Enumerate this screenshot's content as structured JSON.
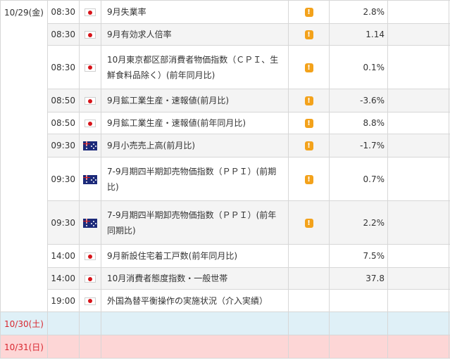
{
  "colors": {
    "saturday_row": "#dff0f7",
    "sunday_row": "#fdd6d6",
    "weekend_date_text": "#d8262e",
    "importance_icon": "#f3a21b"
  },
  "days": [
    {
      "date": "10/29(金)",
      "events": [
        {
          "time": "08:30",
          "country_icon": "japan-flag-icon",
          "name": "9月失業率",
          "importance_icon": "exclamation-icon",
          "importance_label": "!",
          "previous": "2.8%"
        },
        {
          "time": "08:30",
          "country_icon": "japan-flag-icon",
          "name": "9月有効求人倍率",
          "importance_icon": "exclamation-icon",
          "importance_label": "!",
          "previous": "1.14"
        },
        {
          "time": "08:30",
          "country_icon": "japan-flag-icon",
          "name": "10月東京都区部消費者物価指数（ＣＰＩ、生鮮食料品除く）(前年同月比)",
          "importance_icon": "exclamation-icon",
          "importance_label": "!",
          "previous": "0.1%"
        },
        {
          "time": "08:50",
          "country_icon": "japan-flag-icon",
          "name": "9月鉱工業生産・速報値(前月比)",
          "importance_icon": "exclamation-icon",
          "importance_label": "!",
          "previous": "-3.6%"
        },
        {
          "time": "08:50",
          "country_icon": "japan-flag-icon",
          "name": "9月鉱工業生産・速報値(前年同月比)",
          "importance_icon": "exclamation-icon",
          "importance_label": "!",
          "previous": "8.8%"
        },
        {
          "time": "09:30",
          "country_icon": "australia-flag-icon",
          "name": "9月小売売上高(前月比)",
          "importance_icon": "exclamation-icon",
          "importance_label": "!",
          "previous": "-1.7%"
        },
        {
          "time": "09:30",
          "country_icon": "australia-flag-icon",
          "name": "7-9月期四半期卸売物価指数（ＰＰＩ）(前期比)",
          "importance_icon": "exclamation-icon",
          "importance_label": "!",
          "previous": "0.7%"
        },
        {
          "time": "09:30",
          "country_icon": "australia-flag-icon",
          "name": "7-9月期四半期卸売物価指数（ＰＰＩ）(前年同期比)",
          "importance_icon": "exclamation-icon",
          "importance_label": "!",
          "previous": "2.2%"
        },
        {
          "time": "14:00",
          "country_icon": "japan-flag-icon",
          "name": "9月新設住宅着工戸数(前年同月比)",
          "importance_icon": null,
          "importance_label": "",
          "previous": "7.5%"
        },
        {
          "time": "14:00",
          "country_icon": "japan-flag-icon",
          "name": "10月消費者態度指数・一般世帯",
          "importance_icon": null,
          "importance_label": "",
          "previous": "37.8"
        },
        {
          "time": "19:00",
          "country_icon": "japan-flag-icon",
          "name": "外国為替平衡操作の実施状況（介入実績）",
          "importance_icon": null,
          "importance_label": "",
          "previous": ""
        }
      ]
    },
    {
      "date": "10/30(土)",
      "type": "saturday",
      "events": []
    },
    {
      "date": "10/31(日)",
      "type": "sunday",
      "events": []
    }
  ]
}
